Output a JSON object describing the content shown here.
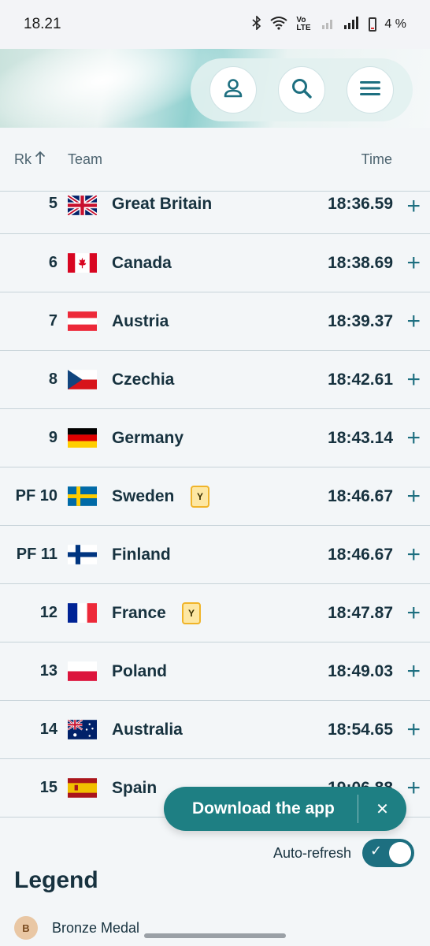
{
  "status_bar": {
    "time": "18.21",
    "network_label": "Vo LTE",
    "battery_percent": "4 %"
  },
  "header": {
    "buttons": [
      {
        "icon": "user-icon"
      },
      {
        "icon": "search-icon"
      },
      {
        "icon": "menu-icon"
      }
    ]
  },
  "table": {
    "headers": {
      "rank": "Rk",
      "team": "Team",
      "time": "Time"
    },
    "rows": [
      {
        "rank": "5",
        "team": "Great Britain",
        "time": "18:36.59",
        "flag": "gb",
        "badge": ""
      },
      {
        "rank": "6",
        "team": "Canada",
        "time": "18:38.69",
        "flag": "ca",
        "badge": ""
      },
      {
        "rank": "7",
        "team": "Austria",
        "time": "18:39.37",
        "flag": "at",
        "badge": ""
      },
      {
        "rank": "8",
        "team": "Czechia",
        "time": "18:42.61",
        "flag": "cz",
        "badge": ""
      },
      {
        "rank": "9",
        "team": "Germany",
        "time": "18:43.14",
        "flag": "de",
        "badge": ""
      },
      {
        "rank": "PF 10",
        "team": "Sweden",
        "time": "18:46.67",
        "flag": "se",
        "badge": "Y"
      },
      {
        "rank": "PF 11",
        "team": "Finland",
        "time": "18:46.67",
        "flag": "fi",
        "badge": ""
      },
      {
        "rank": "12",
        "team": "France",
        "time": "18:47.87",
        "flag": "fr",
        "badge": "Y"
      },
      {
        "rank": "13",
        "team": "Poland",
        "time": "18:49.03",
        "flag": "pl",
        "badge": ""
      },
      {
        "rank": "14",
        "team": "Australia",
        "time": "18:54.65",
        "flag": "au",
        "badge": ""
      },
      {
        "rank": "15",
        "team": "Spain",
        "time": "19:06.88",
        "flag": "es",
        "badge": ""
      }
    ],
    "expand_symbol": "+"
  },
  "download_banner": {
    "label": "Download the app",
    "close": "✕"
  },
  "auto_refresh": {
    "label": "Auto-refresh",
    "enabled": true
  },
  "legend": {
    "title": "Legend",
    "items": [
      {
        "marker": "B",
        "label": "Bronze Medal"
      }
    ]
  },
  "colors": {
    "accent": "#1d6f80",
    "banner": "#1e7f83",
    "text": "#17323f"
  }
}
